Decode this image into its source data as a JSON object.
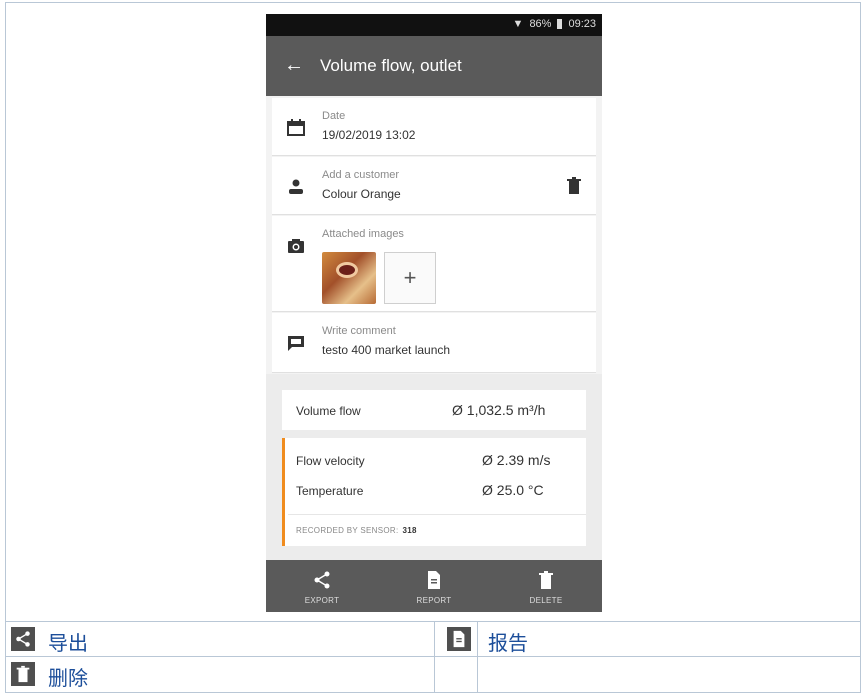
{
  "status_bar": {
    "battery": "86%",
    "time": "09:23"
  },
  "app_bar": {
    "title": "Volume flow, outlet",
    "back_icon": "arrow-left-icon"
  },
  "details": {
    "date": {
      "label": "Date",
      "value": "19/02/2019 13:02"
    },
    "customer": {
      "label": "Add a customer",
      "value": "Colour Orange"
    },
    "images": {
      "label": "Attached images",
      "add_symbol": "+"
    },
    "comment": {
      "label": "Write comment",
      "value": "testo 400 market launch"
    }
  },
  "results": {
    "volume_flow": {
      "name": "Volume flow",
      "value": "Ø 1,032.5 m³/h"
    },
    "flow_velocity": {
      "name": "Flow velocity",
      "value": "Ø 2.39 m/s"
    },
    "temperature": {
      "name": "Temperature",
      "value": "Ø 25.0 °C"
    },
    "sensor": {
      "label": "RECORDED BY SENSOR:",
      "id": "318"
    }
  },
  "bottom_nav": [
    {
      "label": "EXPORT",
      "icon": "share-icon"
    },
    {
      "label": "REPORT",
      "icon": "document-icon"
    },
    {
      "label": "DELETE",
      "icon": "trash-icon"
    }
  ],
  "legend": {
    "export": "导出",
    "report": "报告",
    "delete": "删除"
  },
  "colors": {
    "app_bar": "#5a5a5a",
    "accent": "#f08c1e",
    "legend_text": "#1c4e9a"
  }
}
